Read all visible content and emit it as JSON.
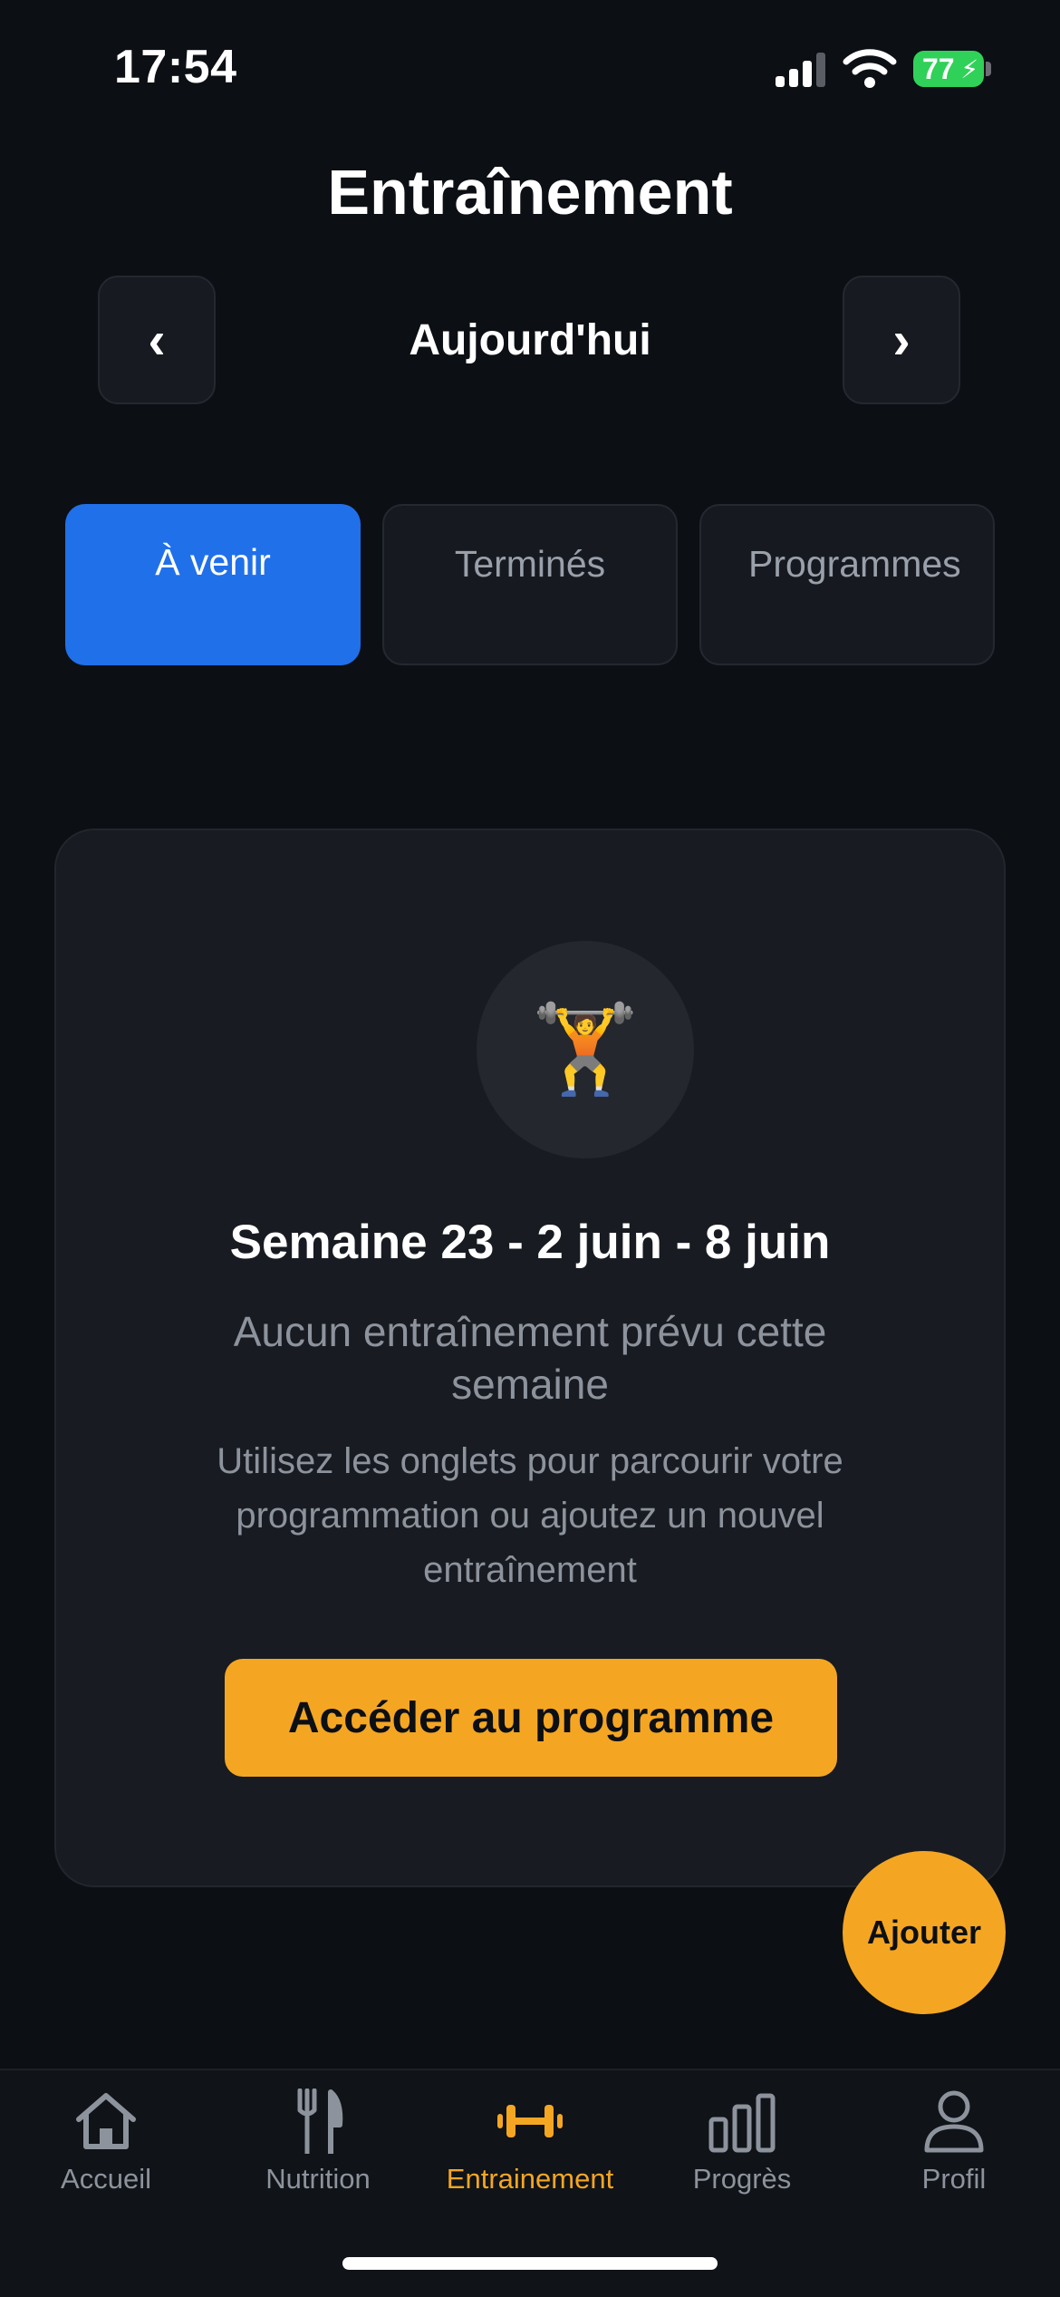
{
  "status": {
    "time": "17:54",
    "battery": "77"
  },
  "header": {
    "title": "Entraînement"
  },
  "date_nav": {
    "prev": "‹",
    "label": "Aujourd'hui",
    "next": "›"
  },
  "tabs": [
    {
      "label": "À venir",
      "active": true
    },
    {
      "label": "Terminés",
      "active": false
    },
    {
      "label": "Programmes",
      "active": false
    }
  ],
  "empty_card": {
    "icon": "🏋️",
    "week": "Semaine 23 - 2 juin - 8 juin",
    "message": "Aucun entraînement prévu cette semaine",
    "hint": "Utilisez les onglets pour parcourir votre programmation ou ajoutez un nouvel entraînement",
    "cta": "Accéder au programme"
  },
  "fab": {
    "label": "Ajouter"
  },
  "tabbar": [
    {
      "label": "Accueil",
      "icon": "home-icon"
    },
    {
      "label": "Nutrition",
      "icon": "fork-knife-icon"
    },
    {
      "label": "Entrainement",
      "icon": "dumbbell-icon",
      "active": true
    },
    {
      "label": "Progrès",
      "icon": "bar-chart-icon"
    },
    {
      "label": "Profil",
      "icon": "person-icon"
    }
  ],
  "colors": {
    "accent": "#f4a623",
    "tab_active": "#2070ea",
    "background": "#0c0f14",
    "card": "#181b21"
  }
}
